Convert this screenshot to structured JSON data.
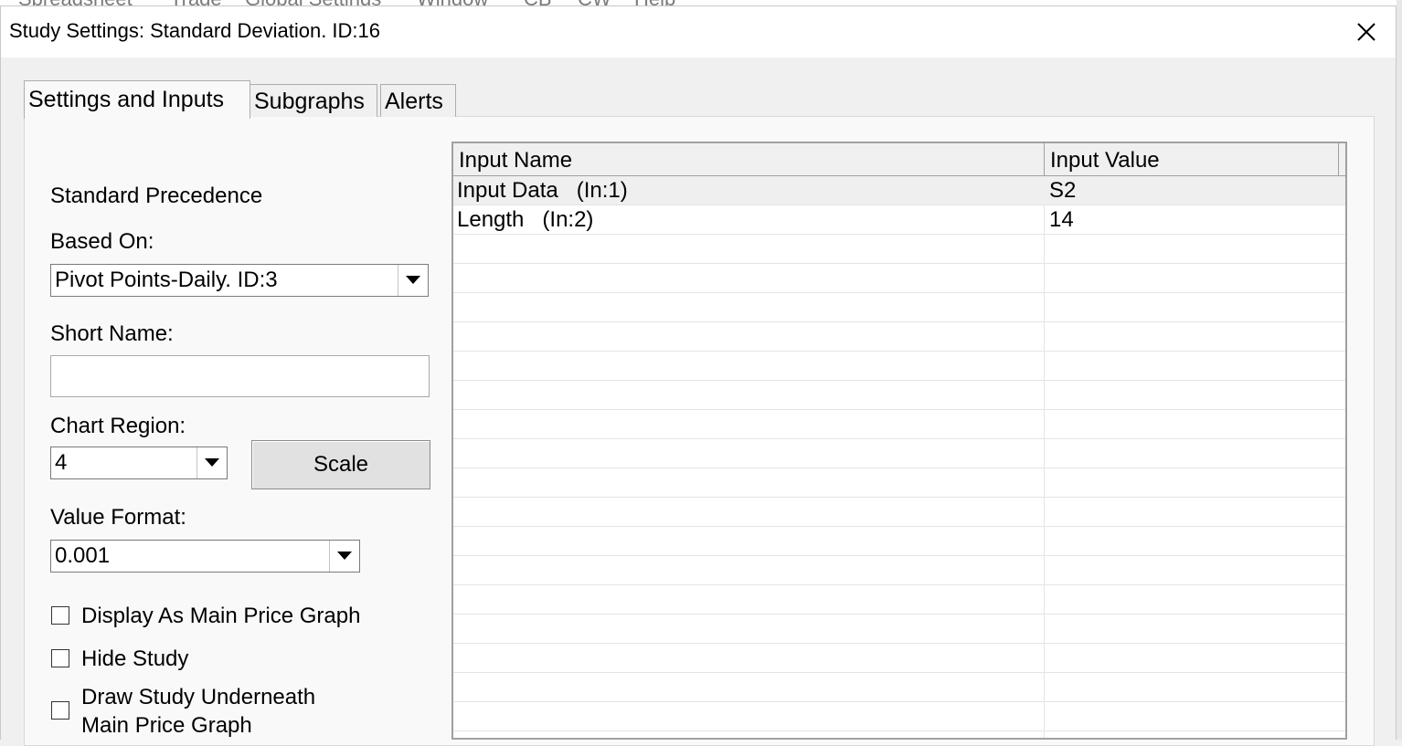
{
  "background_menu": {
    "items": [
      "Spreadsheet",
      "Trade",
      "Global Settings",
      "Window",
      "CB",
      "CW",
      "Help"
    ]
  },
  "dialog": {
    "title": "Study Settings: Standard Deviation. ID:16",
    "close_glyph": "close-icon"
  },
  "tabs": [
    {
      "label": "Settings and Inputs",
      "active": true
    },
    {
      "label": "Subgraphs",
      "active": false
    },
    {
      "label": "Alerts",
      "active": false
    }
  ],
  "left_panel": {
    "precedence_label": "Standard Precedence",
    "based_on_label": "Based On:",
    "based_on_value": "Pivot Points-Daily. ID:3",
    "short_name_label": "Short Name:",
    "short_name_value": "",
    "chart_region_label": "Chart Region:",
    "chart_region_value": "4",
    "scale_button": "Scale",
    "value_format_label": "Value Format:",
    "value_format_value": "0.001",
    "checkboxes": [
      {
        "label": "Display As Main Price Graph",
        "checked": false
      },
      {
        "label": "Hide Study",
        "checked": false
      },
      {
        "label_line1": "Draw Study Underneath",
        "label_line2": "Main Price Graph",
        "checked": false
      }
    ]
  },
  "inputs_grid": {
    "columns": [
      "Input Name",
      "Input Value"
    ],
    "rows": [
      {
        "name": "Input Data   (In:1)",
        "value": "S2"
      },
      {
        "name": "Length   (In:2)",
        "value": "14"
      }
    ]
  },
  "colors": {
    "dialog_bg": "#f0f0f0",
    "panel_bg": "#f9f9f9",
    "selected_row": "#efefef"
  }
}
